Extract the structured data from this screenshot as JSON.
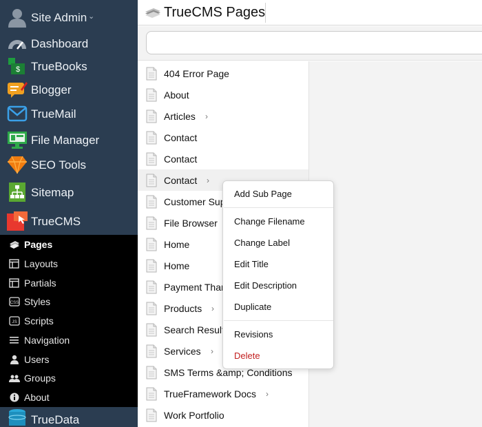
{
  "sidebar": {
    "user": {
      "label": "Site Admin",
      "caret": "⌄",
      "icon": "user-icon"
    },
    "apps": [
      {
        "label": "Dashboard",
        "icon": "gauge-icon"
      },
      {
        "label": "TrueBooks",
        "icon": "ledger-icon"
      },
      {
        "label": "Blogger",
        "icon": "blog-icon"
      },
      {
        "label": "TrueMail",
        "icon": "mail-icon"
      },
      {
        "label": "File Manager",
        "icon": "file-manager-icon"
      },
      {
        "label": "SEO Tools",
        "icon": "diamond-icon"
      },
      {
        "label": "Sitemap",
        "icon": "sitemap-icon"
      },
      {
        "label": "TrueCMS",
        "icon": "cms-icon"
      }
    ],
    "subnav": [
      {
        "label": "Pages",
        "icon": "pages-icon",
        "active": true
      },
      {
        "label": "Layouts",
        "icon": "layout-icon"
      },
      {
        "label": "Partials",
        "icon": "partial-icon"
      },
      {
        "label": "Styles",
        "icon": "css-icon"
      },
      {
        "label": "Scripts",
        "icon": "js-icon"
      },
      {
        "label": "Navigation",
        "icon": "menu-icon"
      },
      {
        "label": "Users",
        "icon": "user-icon"
      },
      {
        "label": "Groups",
        "icon": "group-icon"
      },
      {
        "label": "About",
        "icon": "info-icon"
      }
    ],
    "truedata": {
      "label": "TrueData",
      "icon": "database-icon"
    }
  },
  "header": {
    "title": "TrueCMS Pages",
    "icon": "pages-stack-icon"
  },
  "search": {
    "value": "",
    "placeholder": ""
  },
  "pages": [
    {
      "name": "404 Error Page",
      "children": false
    },
    {
      "name": "About",
      "children": false
    },
    {
      "name": "Articles",
      "children": true
    },
    {
      "name": "Contact",
      "children": false
    },
    {
      "name": "Contact",
      "children": false
    },
    {
      "name": "Contact",
      "children": true,
      "hover": true
    },
    {
      "name": "Customer Support",
      "children": false
    },
    {
      "name": "File Browser",
      "children": false
    },
    {
      "name": "Home",
      "children": false
    },
    {
      "name": "Home",
      "children": false
    },
    {
      "name": "Payment Thank You",
      "children": false
    },
    {
      "name": "Products",
      "children": true
    },
    {
      "name": "Search Results",
      "children": false
    },
    {
      "name": "Services",
      "children": true
    },
    {
      "name": "SMS Terms &amp; Conditions",
      "children": false
    },
    {
      "name": "TrueFramework Docs",
      "children": true
    },
    {
      "name": "Work Portfolio",
      "children": false
    }
  ],
  "context_menu": {
    "items": [
      {
        "label": "Add Sub Page"
      },
      {
        "label": "Change Filename"
      },
      {
        "label": "Change Label"
      },
      {
        "label": "Edit Title"
      },
      {
        "label": "Edit Description"
      },
      {
        "label": "Duplicate"
      },
      {
        "label": "Revisions"
      },
      {
        "label": "Delete",
        "danger": true
      }
    ]
  },
  "colors": {
    "sidebar": "#2b3d51",
    "subnav": "#000000",
    "danger": "#c21f1f",
    "pane": "#f3f3f3"
  }
}
